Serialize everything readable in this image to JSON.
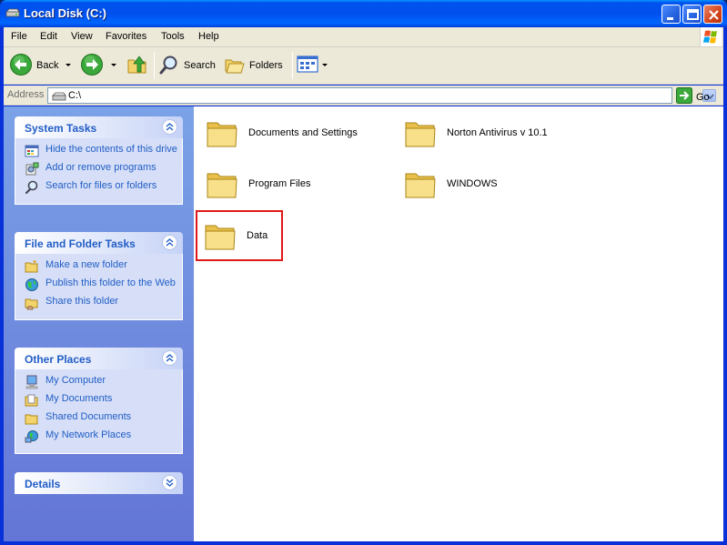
{
  "window": {
    "title": "Local Disk (C:)"
  },
  "menu": [
    "File",
    "Edit",
    "View",
    "Favorites",
    "Tools",
    "Help"
  ],
  "toolbar": {
    "back_label": "Back",
    "search_label": "Search",
    "folders_label": "Folders"
  },
  "address": {
    "label": "Address",
    "value": "C:\\",
    "go_label": "Go"
  },
  "task_pane": {
    "system_tasks": {
      "title": "System Tasks",
      "items": [
        {
          "label": "Hide the contents of this drive",
          "icon": "hide-contents-icon"
        },
        {
          "label": "Add or remove programs",
          "icon": "add-remove-programs-icon"
        },
        {
          "label": "Search for files or folders",
          "icon": "search-icon"
        }
      ]
    },
    "file_folder_tasks": {
      "title": "File and Folder Tasks",
      "items": [
        {
          "label": "Make a new folder",
          "icon": "new-folder-icon"
        },
        {
          "label": "Publish this folder to the Web",
          "icon": "publish-web-icon"
        },
        {
          "label": "Share this folder",
          "icon": "share-folder-icon"
        }
      ]
    },
    "other_places": {
      "title": "Other Places",
      "items": [
        {
          "label": "My Computer",
          "icon": "my-computer-icon"
        },
        {
          "label": "My Documents",
          "icon": "my-documents-icon"
        },
        {
          "label": "Shared Documents",
          "icon": "shared-documents-icon"
        },
        {
          "label": "My Network Places",
          "icon": "network-places-icon"
        }
      ]
    },
    "details": {
      "title": "Details"
    }
  },
  "folders": [
    {
      "name": "Documents and Settings"
    },
    {
      "name": "Norton Antivirus v 10.1"
    },
    {
      "name": "Program Files"
    },
    {
      "name": "WINDOWS"
    },
    {
      "name": "Data",
      "highlighted": true
    }
  ],
  "colors": {
    "title_bar": "#0053ee",
    "task_link": "#215dc6",
    "task_pane_bg": "#6375d6",
    "highlight_border": "#e01818"
  }
}
